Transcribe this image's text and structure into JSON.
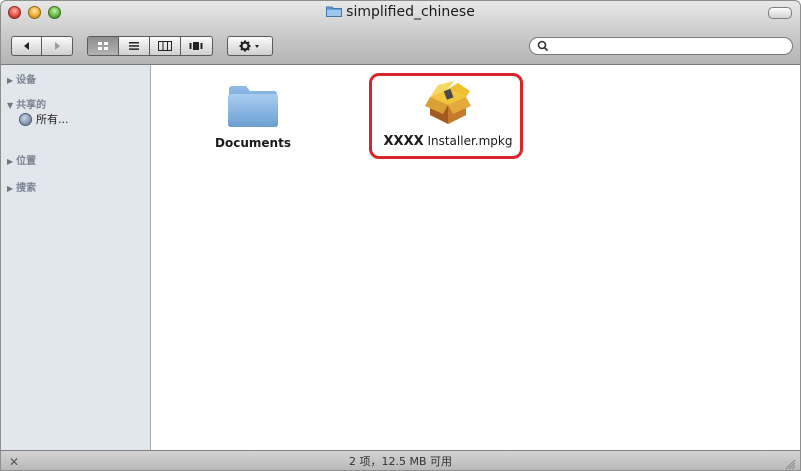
{
  "window": {
    "title": "simplified_chinese"
  },
  "toolbar": {
    "nav": [
      "back-icon",
      "forward-icon"
    ],
    "views": [
      "icon-view-icon",
      "list-view-icon",
      "column-view-icon",
      "coverflow-view-icon"
    ],
    "action_icon": "gear-icon",
    "search_placeholder": ""
  },
  "sidebar": {
    "devices": "设备",
    "shared": "共享的",
    "shared_all": "所有...",
    "places": "位置",
    "search_for": "搜索"
  },
  "files": [
    {
      "name": "Documents",
      "icon": "folder-icon"
    },
    {
      "name_bold": "XXXX",
      "name_rest": " Installer.mpkg",
      "icon": "package-icon"
    }
  ],
  "status": {
    "text": "2 项，12.5 MB 可用"
  },
  "colors": {
    "highlight": "#d7252b",
    "sidebar_bg": "#e2e7ee"
  }
}
